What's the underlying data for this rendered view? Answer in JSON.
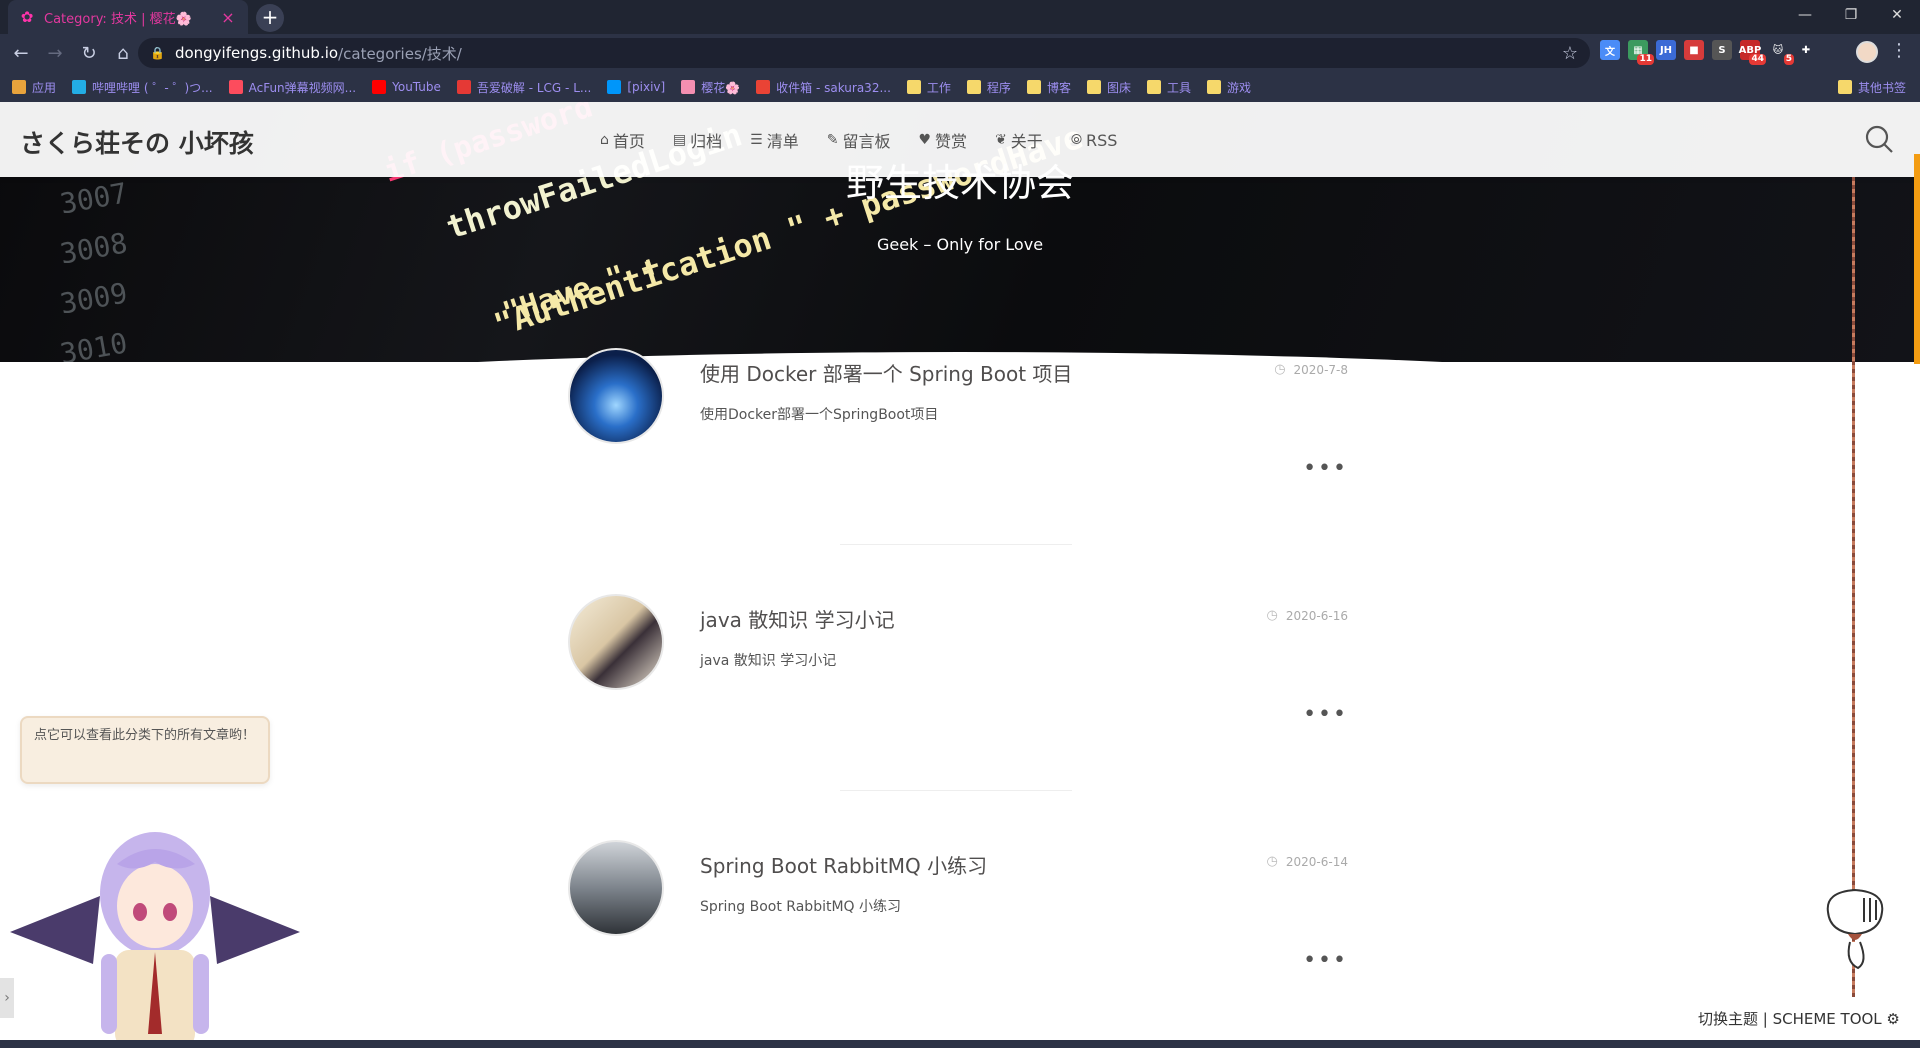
{
  "browser": {
    "tab": {
      "title": "Category: 技术 | 樱花🌸",
      "close": "×"
    },
    "new_tab": "+",
    "window": {
      "minimize": "—",
      "restore": "❐",
      "close": "✕"
    },
    "url": {
      "host": "dongyifengs.github.io",
      "path": "/categories/技术/"
    },
    "extensions": [
      {
        "icon": "translate-icon",
        "color": "#4a8cf7",
        "label": "文"
      },
      {
        "icon": "grid-ext-icon",
        "color": "#3c9a5f",
        "label": "▦",
        "badge": "11"
      },
      {
        "icon": "jh-icon",
        "color": "#3b6bd6",
        "label": "JH"
      },
      {
        "icon": "red-ext-icon",
        "color": "#d63b3b",
        "label": "■"
      },
      {
        "icon": "s-ext-icon",
        "color": "#555555",
        "label": "S"
      },
      {
        "icon": "abp-icon",
        "color": "#c62828",
        "label": "ABP",
        "badge": "44"
      },
      {
        "icon": "cat-ext-icon",
        "color": "#2c3245",
        "label": "🐱",
        "badge": "5"
      },
      {
        "icon": "puzzle-icon",
        "color": "#2c3245",
        "label": "✚"
      }
    ],
    "bookmarks": [
      {
        "label": "应用",
        "icon": "apps-icon",
        "color": "#e8a33c"
      },
      {
        "label": "哔哩哔哩 ( ゜- ゜)つ...",
        "icon": "bilibili-icon",
        "color": "#23ade5"
      },
      {
        "label": "AcFun弹幕视频网...",
        "icon": "acfun-icon",
        "color": "#fd4c5d"
      },
      {
        "label": "YouTube",
        "icon": "youtube-icon",
        "color": "#ff0000"
      },
      {
        "label": "吾爱破解 - LCG - L...",
        "icon": "52pojie-icon",
        "color": "#e53935"
      },
      {
        "label": "[pixiv]",
        "icon": "pixiv-icon",
        "color": "#0096fa"
      },
      {
        "label": "樱花🌸",
        "icon": "sakura-icon",
        "color": "#f48fb1"
      },
      {
        "label": "收件箱 - sakura32...",
        "icon": "gmail-icon",
        "color": "#ea4335"
      },
      {
        "label": "工作",
        "icon": "folder-icon",
        "color": "#f6d86b"
      },
      {
        "label": "程序",
        "icon": "folder-icon",
        "color": "#f6d86b"
      },
      {
        "label": "博客",
        "icon": "folder-icon",
        "color": "#f6d86b"
      },
      {
        "label": "图床",
        "icon": "folder-icon",
        "color": "#f6d86b"
      },
      {
        "label": "工具",
        "icon": "folder-icon",
        "color": "#f6d86b"
      },
      {
        "label": "游戏",
        "icon": "folder-icon",
        "color": "#f6d86b"
      }
    ],
    "other_bookmarks": "其他书签"
  },
  "site": {
    "title": "さくら荘その 小坏孩",
    "menu": [
      {
        "icon": "⌂",
        "label": "首页"
      },
      {
        "icon": "▤",
        "label": "归档"
      },
      {
        "icon": "☰",
        "label": "清单"
      },
      {
        "icon": "✎",
        "label": "留言板"
      },
      {
        "icon": "♥",
        "label": "赞赏"
      },
      {
        "icon": "❦",
        "label": "关于"
      },
      {
        "icon": "⦾",
        "label": "RSS"
      }
    ],
    "hero": {
      "title": "野生技术协会",
      "subtitle": "Geek – Only for Love"
    }
  },
  "posts": [
    {
      "title": "使用 Docker 部署一个 Spring Boot 项目",
      "date": "2020-7-8",
      "excerpt": "使用Docker部署一个SpringBoot项目",
      "more": "•••"
    },
    {
      "title": "java 散知识 学习小记",
      "date": "2020-6-16",
      "excerpt": "java 散知识 学习小记",
      "more": "•••"
    },
    {
      "title": "Spring Boot RabbitMQ 小练习",
      "date": "2020-6-14",
      "excerpt": "Spring Boot RabbitMQ 小练习",
      "more": "•••"
    }
  ],
  "widgets": {
    "tip": "点它可以查看此分类下的所有文章哟！",
    "scheme_tool": "切换主题 | SCHEME TOOL ⚙"
  },
  "colors": {
    "accent": "#e4389f",
    "scroll": "#f39c12",
    "chrome_bg": "#2c3245"
  }
}
